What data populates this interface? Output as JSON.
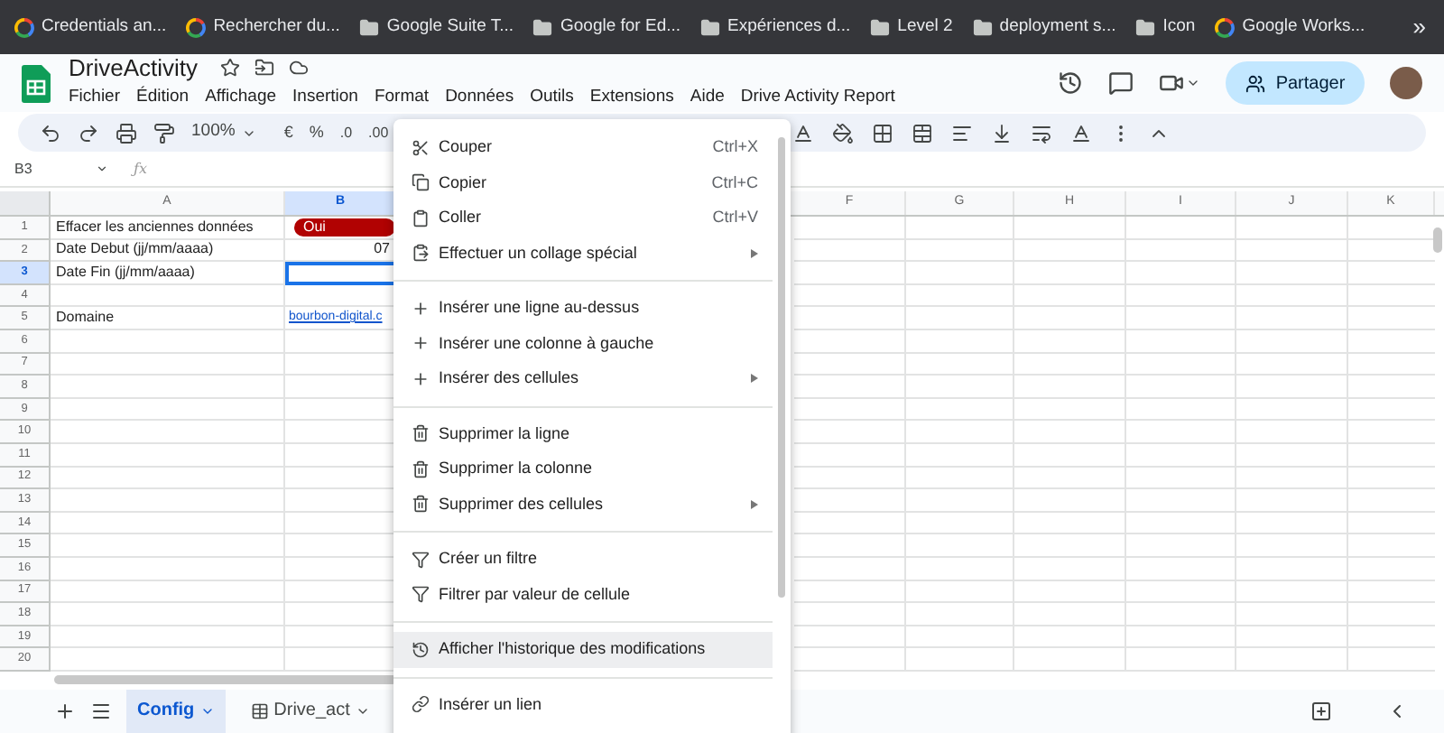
{
  "bookmarks": [
    {
      "label": "Credentials an...",
      "kind": "site"
    },
    {
      "label": "Rechercher du...",
      "kind": "site"
    },
    {
      "label": "Google Suite T...",
      "kind": "folder"
    },
    {
      "label": "Google for Ed...",
      "kind": "folder"
    },
    {
      "label": "Expériences d...",
      "kind": "folder"
    },
    {
      "label": "Level 2",
      "kind": "folder"
    },
    {
      "label": "deployment s...",
      "kind": "folder"
    },
    {
      "label": "Icon",
      "kind": "folder"
    },
    {
      "label": "Google Works...",
      "kind": "site"
    }
  ],
  "bookmarks_more": "»",
  "document": {
    "title": "DriveActivity"
  },
  "menu_bar": [
    "Fichier",
    "Édition",
    "Affichage",
    "Insertion",
    "Format",
    "Données",
    "Outils",
    "Extensions",
    "Aide",
    "Drive Activity Report"
  ],
  "share_button": "Partager",
  "toolbar": {
    "zoom": "100%",
    "currency": "€",
    "percent": "%",
    "decrease_decimals": ".0",
    "increase_decimals": ".00"
  },
  "name_box": "B3",
  "formula_label": "ƒx",
  "columns": [
    {
      "label": "A",
      "selected": false
    },
    {
      "label": "B",
      "selected": true
    },
    {
      "label": "F",
      "selected": false
    },
    {
      "label": "G",
      "selected": false
    },
    {
      "label": "H",
      "selected": false
    },
    {
      "label": "I",
      "selected": false
    },
    {
      "label": "J",
      "selected": false
    },
    {
      "label": "K",
      "selected": false
    }
  ],
  "rows": [
    {
      "number": "1",
      "selected": false,
      "cells": [
        {
          "kind": "text",
          "text": "Effacer les anciennes données",
          "selected": false
        },
        {
          "kind": "chip",
          "text": "Oui",
          "selected": false
        }
      ]
    },
    {
      "number": "2",
      "selected": false,
      "cells": [
        {
          "kind": "text",
          "text": "Date Debut (jj/mm/aaaa)",
          "selected": false
        },
        {
          "kind": "number",
          "text": "07",
          "selected": false
        }
      ]
    },
    {
      "number": "3",
      "selected": true,
      "cells": [
        {
          "kind": "text",
          "text": "Date Fin (jj/mm/aaaa)",
          "selected": false
        },
        {
          "kind": "empty",
          "selected": true
        }
      ]
    },
    {
      "number": "4",
      "selected": false
    },
    {
      "number": "5",
      "selected": false,
      "cells": [
        {
          "kind": "text",
          "text": "Domaine",
          "selected": false
        },
        {
          "kind": "link",
          "text": "bourbon-digital.c",
          "selected": false
        }
      ]
    },
    {
      "number": "6",
      "selected": false
    },
    {
      "number": "7",
      "selected": false
    },
    {
      "number": "8",
      "selected": false
    },
    {
      "number": "9",
      "selected": false
    },
    {
      "number": "10",
      "selected": false
    },
    {
      "number": "11",
      "selected": false
    },
    {
      "number": "12",
      "selected": false
    },
    {
      "number": "13",
      "selected": false
    },
    {
      "number": "14",
      "selected": false
    },
    {
      "number": "15",
      "selected": false
    },
    {
      "number": "16",
      "selected": false
    },
    {
      "number": "17",
      "selected": false
    },
    {
      "number": "18",
      "selected": false
    },
    {
      "number": "19",
      "selected": false
    },
    {
      "number": "20",
      "selected": false
    }
  ],
  "context_menu": [
    {
      "items": [
        {
          "label": "Couper",
          "shortcut": "Ctrl+X",
          "submenu": false,
          "selected": false
        },
        {
          "label": "Copier",
          "shortcut": "Ctrl+C",
          "submenu": false,
          "selected": false
        },
        {
          "label": "Coller",
          "shortcut": "Ctrl+V",
          "submenu": false,
          "selected": false
        },
        {
          "label": "Effectuer un collage spécial",
          "submenu": true,
          "selected": false
        }
      ]
    },
    {
      "items": [
        {
          "label": "Insérer une ligne au-dessus",
          "submenu": false,
          "selected": false
        },
        {
          "label": "Insérer une colonne à gauche",
          "submenu": false,
          "selected": false
        },
        {
          "label": "Insérer des cellules",
          "submenu": true,
          "selected": false
        }
      ]
    },
    {
      "items": [
        {
          "label": "Supprimer la ligne",
          "submenu": false,
          "selected": false
        },
        {
          "label": "Supprimer la colonne",
          "submenu": false,
          "selected": false
        },
        {
          "label": "Supprimer des cellules",
          "submenu": true,
          "selected": false
        }
      ]
    },
    {
      "items": [
        {
          "label": "Créer un filtre",
          "submenu": false,
          "selected": false
        },
        {
          "label": "Filtrer par valeur de cellule",
          "submenu": false,
          "selected": false
        }
      ]
    },
    {
      "items": [
        {
          "label": "Afficher l'historique des modifications",
          "submenu": false,
          "selected": true
        }
      ]
    },
    {
      "items": [
        {
          "label": "Insérer un lien",
          "submenu": false,
          "selected": false
        }
      ]
    }
  ],
  "sheet_tabs": [
    {
      "label": "Config",
      "selected": true,
      "kind": "plain"
    },
    {
      "label": "Drive_act",
      "selected": false,
      "kind": "data"
    }
  ]
}
